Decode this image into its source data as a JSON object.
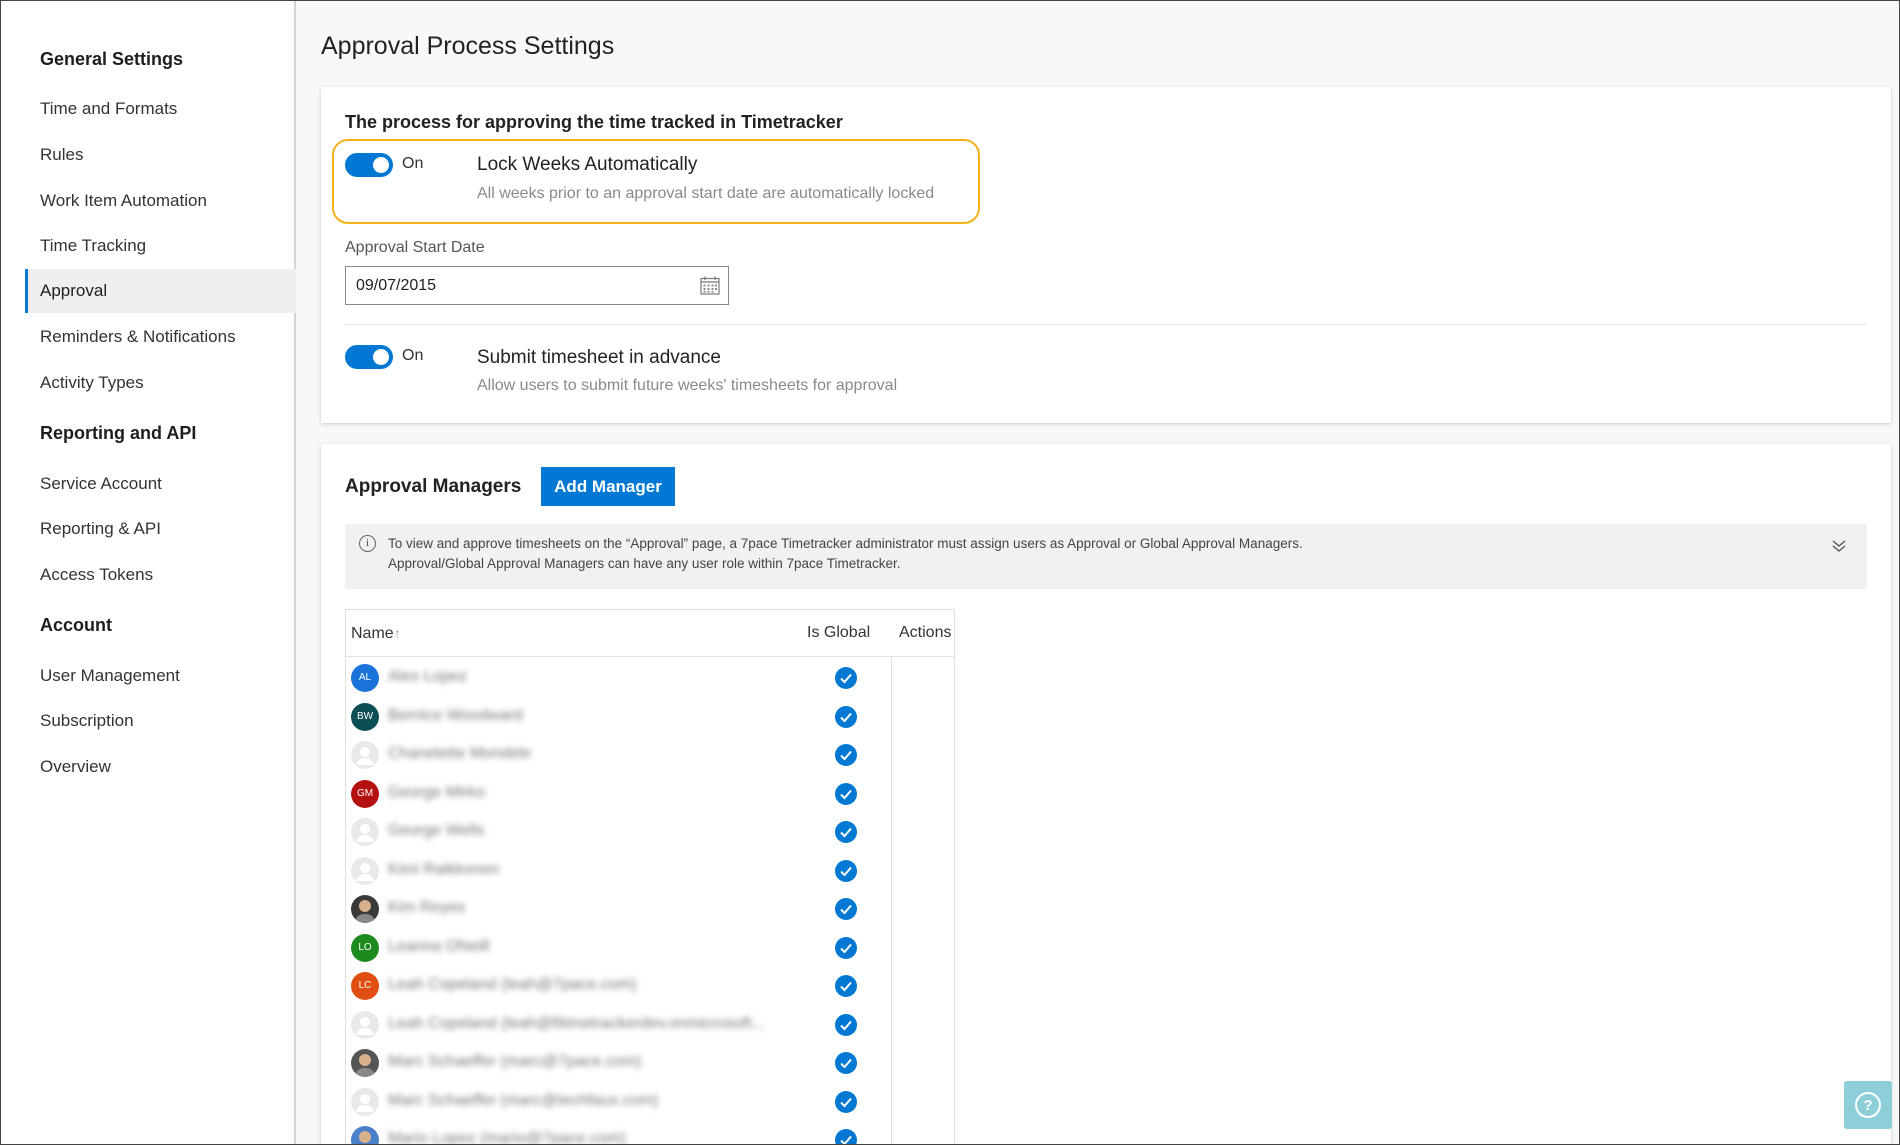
{
  "sidebar": {
    "sections": [
      {
        "title": "General Settings"
      },
      {
        "title": "Reporting and API"
      },
      {
        "title": "Account"
      }
    ],
    "items": [
      {
        "label": "Time and Formats"
      },
      {
        "label": "Rules"
      },
      {
        "label": "Work Item Automation"
      },
      {
        "label": "Time Tracking"
      },
      {
        "label": "Approval"
      },
      {
        "label": "Reminders & Notifications"
      },
      {
        "label": "Activity Types"
      },
      {
        "label": "Service Account"
      },
      {
        "label": "Reporting & API"
      },
      {
        "label": "Access Tokens"
      },
      {
        "label": "User Management"
      },
      {
        "label": "Subscription"
      },
      {
        "label": "Overview"
      }
    ],
    "active_item": "Approval"
  },
  "page": {
    "title": "Approval Process Settings"
  },
  "process": {
    "title": "The process for approving the time tracked in Timetracker",
    "lock_weeks": {
      "toggle_state": "On",
      "title": "Lock Weeks Automatically",
      "description": "All weeks prior to an approval start date are automatically locked"
    },
    "start_date": {
      "label": "Approval Start Date",
      "value": "09/07/2015"
    },
    "submit_advance": {
      "toggle_state": "On",
      "title": "Submit timesheet in advance",
      "description": "Allow users to submit future weeks' timesheets for approval"
    }
  },
  "managers": {
    "title": "Approval Managers",
    "add_button": "Add Manager",
    "info_line1": "To view and approve timesheets on the “Approval” page, a 7pace Timetracker administrator must assign users as Approval or Global Approval Managers.",
    "info_line2": "Approval/Global Approval Managers can have any user role within 7pace Timetracker.",
    "columns": {
      "name": "Name",
      "sort_indicator": "↑",
      "is_global": "Is Global",
      "actions": "Actions"
    },
    "rows": [
      {
        "initials": "AL",
        "name": "Alex Lopez",
        "color": "#1a73d9"
      },
      {
        "initials": "BW",
        "name": "Bernice Woodward",
        "color": "#0b4f55"
      },
      {
        "initials": "",
        "name": "Chanelette Mondele",
        "color": "#e9e9e9"
      },
      {
        "initials": "GM",
        "name": "George Mirko",
        "color": "#b51010"
      },
      {
        "initials": "",
        "name": "George Wells",
        "color": "#e9e9e9"
      },
      {
        "initials": "",
        "name": "Kimi Raikkonen",
        "color": "#e9e9e9"
      },
      {
        "initials": "",
        "name": "Kim Reyes",
        "color": "#3a3a3a"
      },
      {
        "initials": "LO",
        "name": "Leanna ONeill",
        "color": "#1d8a1d"
      },
      {
        "initials": "LC",
        "name": "Leah Copeland (leah@7pace.com)",
        "color": "#e04e12"
      },
      {
        "initials": "",
        "name": "Leah Copeland (leah@fitimetrackerdev.onmicrosoft...",
        "color": "#e9e9e9"
      },
      {
        "initials": "",
        "name": "Marc Schaeffer (marc@7pace.com)",
        "color": "#555555"
      },
      {
        "initials": "",
        "name": "Marc Schaeffer (marc@techfaux.com)",
        "color": "#e9e9e9"
      },
      {
        "initials": "",
        "name": "Mario Lopez (mario@7pace.com)",
        "color": "#4a7fc9"
      }
    ]
  }
}
